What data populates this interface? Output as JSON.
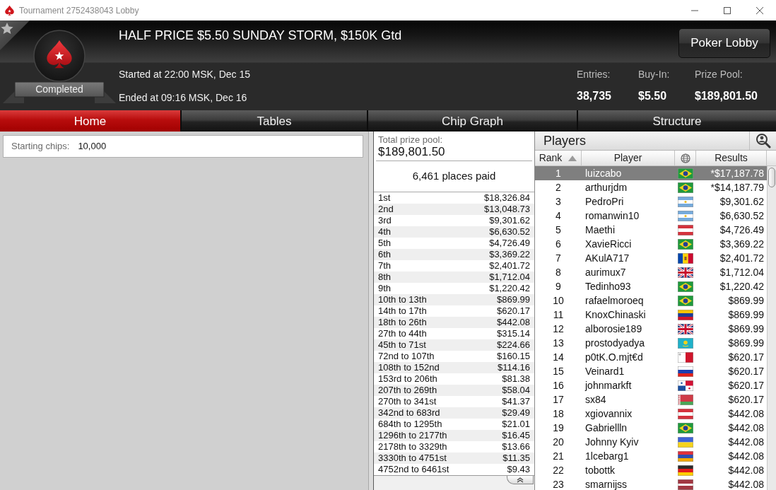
{
  "window": {
    "title": "Tournament 2752438043 Lobby"
  },
  "header": {
    "title": "HALF PRICE $5.50 SUNDAY STORM, $150K Gtd",
    "status": "Completed",
    "lines": [
      "Started at 22:00 MSK, Dec 15",
      "Ended at 09:16 MSK, Dec 16"
    ],
    "button": "Poker Lobby",
    "stats": [
      {
        "label": "Entries:",
        "value": "38,735"
      },
      {
        "label": "Buy-In:",
        "value": "$5.50"
      },
      {
        "label": "Prize Pool:",
        "value": "$189,801.50"
      }
    ]
  },
  "tabs": [
    {
      "label": "Home",
      "selected": true
    },
    {
      "label": "Tables",
      "selected": false
    },
    {
      "label": "Chip Graph",
      "selected": false
    },
    {
      "label": "Structure",
      "selected": false
    }
  ],
  "info": {
    "label": "Starting chips:",
    "value": "10,000"
  },
  "prizes": {
    "total_label": "Total prize pool:",
    "total": "$189,801.50",
    "places_paid": "6,461 places paid",
    "rows": [
      {
        "place": "1st",
        "amount": "$18,326.84"
      },
      {
        "place": "2nd",
        "amount": "$13,048.73"
      },
      {
        "place": "3rd",
        "amount": "$9,301.62"
      },
      {
        "place": "4th",
        "amount": "$6,630.52"
      },
      {
        "place": "5th",
        "amount": "$4,726.49"
      },
      {
        "place": "6th",
        "amount": "$3,369.22"
      },
      {
        "place": "7th",
        "amount": "$2,401.72"
      },
      {
        "place": "8th",
        "amount": "$1,712.04"
      },
      {
        "place": "9th",
        "amount": "$1,220.42"
      },
      {
        "place": "10th to 13th",
        "amount": "$869.99"
      },
      {
        "place": "14th to 17th",
        "amount": "$620.17"
      },
      {
        "place": "18th to 26th",
        "amount": "$442.08"
      },
      {
        "place": "27th to 44th",
        "amount": "$315.14"
      },
      {
        "place": "45th to 71st",
        "amount": "$224.66"
      },
      {
        "place": "72nd to 107th",
        "amount": "$160.15"
      },
      {
        "place": "108th to 152nd",
        "amount": "$114.16"
      },
      {
        "place": "153rd to 206th",
        "amount": "$81.38"
      },
      {
        "place": "207th to 269th",
        "amount": "$58.04"
      },
      {
        "place": "270th to 341st",
        "amount": "$41.37"
      },
      {
        "place": "342nd to 683rd",
        "amount": "$29.49"
      },
      {
        "place": "684th to 1295th",
        "amount": "$21.01"
      },
      {
        "place": "1296th to 2177th",
        "amount": "$16.45"
      },
      {
        "place": "2178th to 3329th",
        "amount": "$13.66"
      },
      {
        "place": "3330th to 4751st",
        "amount": "$11.35"
      },
      {
        "place": "4752nd to 6461st",
        "amount": "$9.43"
      }
    ]
  },
  "players": {
    "title": "Players",
    "columns": [
      {
        "kind": "text",
        "label": "Rank",
        "sorted": true
      },
      {
        "kind": "text",
        "label": "Player",
        "sorted": false
      },
      {
        "kind": "icon",
        "sorted": false
      },
      {
        "kind": "text",
        "label": "Results",
        "sorted": false
      }
    ],
    "rows": [
      {
        "rank": "1",
        "name": "luizcabo",
        "kind": "brazil",
        "result": "*$17,187.78",
        "selected": true
      },
      {
        "rank": "2",
        "name": "arthurjdm",
        "kind": "brazil",
        "result": "*$14,187.79",
        "selected": false
      },
      {
        "rank": "3",
        "name": "PedroPri",
        "kind": "argentina",
        "result": "$9,301.62",
        "selected": false
      },
      {
        "rank": "4",
        "name": "romanwin10",
        "kind": "argentina",
        "result": "$6,630.52",
        "selected": false
      },
      {
        "rank": "5",
        "name": "Maethi",
        "kind": "austria",
        "result": "$4,726.49",
        "selected": false
      },
      {
        "rank": "6",
        "name": "XavieRicci",
        "kind": "brazil",
        "result": "$3,369.22",
        "selected": false
      },
      {
        "rank": "7",
        "name": "AKulA717",
        "kind": "moldova",
        "result": "$2,401.72",
        "selected": false
      },
      {
        "rank": "8",
        "name": "aurimux7",
        "kind": "uk",
        "result": "$1,712.04",
        "selected": false
      },
      {
        "rank": "9",
        "name": "Tedinho93",
        "kind": "brazil",
        "result": "$1,220.42",
        "selected": false
      },
      {
        "rank": "10",
        "name": "rafaelmoroeq",
        "kind": "brazil",
        "result": "$869.99",
        "selected": false
      },
      {
        "rank": "11",
        "name": "KnoxChinaski",
        "kind": "venezuela",
        "result": "$869.99",
        "selected": false
      },
      {
        "rank": "12",
        "name": "alborosie189",
        "kind": "uk",
        "result": "$869.99",
        "selected": false
      },
      {
        "rank": "13",
        "name": "prostodyadya",
        "kind": "kazakhstan",
        "result": "$869.99",
        "selected": false
      },
      {
        "rank": "14",
        "name": "p0tK.O.mjt€d",
        "kind": "malta",
        "result": "$620.17",
        "selected": false
      },
      {
        "rank": "15",
        "name": "Veinard1",
        "kind": "russia",
        "result": "$620.17",
        "selected": false
      },
      {
        "rank": "16",
        "name": "johnmarkft",
        "kind": "panama",
        "result": "$620.17",
        "selected": false
      },
      {
        "rank": "17",
        "name": "sx84",
        "kind": "belarus",
        "result": "$620.17",
        "selected": false
      },
      {
        "rank": "18",
        "name": "xgiovannix",
        "kind": "austria",
        "result": "$442.08",
        "selected": false
      },
      {
        "rank": "19",
        "name": "Gabriellln",
        "kind": "brazil",
        "result": "$442.08",
        "selected": false
      },
      {
        "rank": "20",
        "name": "Johnny Kyiv",
        "kind": "ukraine",
        "result": "$442.08",
        "selected": false
      },
      {
        "rank": "21",
        "name": "1lcebarg1",
        "kind": "armenia",
        "result": "$442.08",
        "selected": false
      },
      {
        "rank": "22",
        "name": "tobottk",
        "kind": "germany",
        "result": "$442.08",
        "selected": false
      },
      {
        "rank": "23",
        "name": "smarnijss",
        "kind": "latvia",
        "result": "$442.08",
        "selected": false
      }
    ]
  }
}
